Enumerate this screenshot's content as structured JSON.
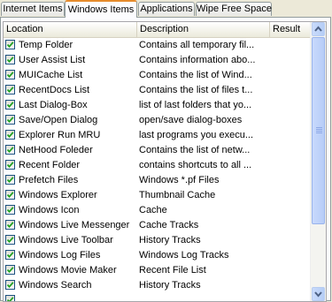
{
  "tabs": [
    {
      "label": "Internet Items",
      "active": false
    },
    {
      "label": "Windows Items",
      "active": true
    },
    {
      "label": "Applications",
      "active": false
    },
    {
      "label": "Wipe Free Space",
      "active": false
    }
  ],
  "columns": {
    "location": "Location",
    "description": "Description",
    "result": "Result"
  },
  "rows": [
    {
      "location": "Temp Folder",
      "description": "Contains all temporary fil...",
      "result": "",
      "checked": true
    },
    {
      "location": "User Assist List",
      "description": "Contains information abo...",
      "result": "",
      "checked": true
    },
    {
      "location": "MUICache List",
      "description": "Contains the list of Wind...",
      "result": "",
      "checked": true
    },
    {
      "location": "RecentDocs List",
      "description": "Contains the list of files t...",
      "result": "",
      "checked": true
    },
    {
      "location": "Last Dialog-Box",
      "description": "list of last folders that yo...",
      "result": "",
      "checked": true
    },
    {
      "location": "Save/Open Dialog",
      "description": "open/save dialog-boxes",
      "result": "",
      "checked": true
    },
    {
      "location": "Explorer Run MRU",
      "description": "last programs you execu...",
      "result": "",
      "checked": true
    },
    {
      "location": "NetHood Foleder",
      "description": "Contains the list of netw...",
      "result": "",
      "checked": true
    },
    {
      "location": "Recent Folder",
      "description": "contains shortcuts to all ...",
      "result": "",
      "checked": true
    },
    {
      "location": "Prefetch Files",
      "description": "Windows *.pf Files",
      "result": "",
      "checked": true
    },
    {
      "location": "Windows Explorer",
      "description": "Thumbnail Cache",
      "result": "",
      "checked": true
    },
    {
      "location": "Windows Icon",
      "description": "Cache",
      "result": "",
      "checked": true
    },
    {
      "location": "Windows Live Messenger",
      "description": "Cache Tracks",
      "result": "",
      "checked": true
    },
    {
      "location": "Windows Live Toolbar",
      "description": "History Tracks",
      "result": "",
      "checked": true
    },
    {
      "location": "Windows Log Files",
      "description": "Windows Log Tracks",
      "result": "",
      "checked": true
    },
    {
      "location": "Windows Movie Maker",
      "description": "Recent File List",
      "result": "",
      "checked": true
    },
    {
      "location": "Windows Search",
      "description": "History Tracks",
      "result": "",
      "checked": true
    },
    {
      "location": "",
      "description": "",
      "result": "",
      "checked": true
    }
  ],
  "colors": {
    "active_tab_accent": "#e68b2c",
    "checkmark": "#21a121",
    "scrollbar": "#c1d3fb"
  }
}
